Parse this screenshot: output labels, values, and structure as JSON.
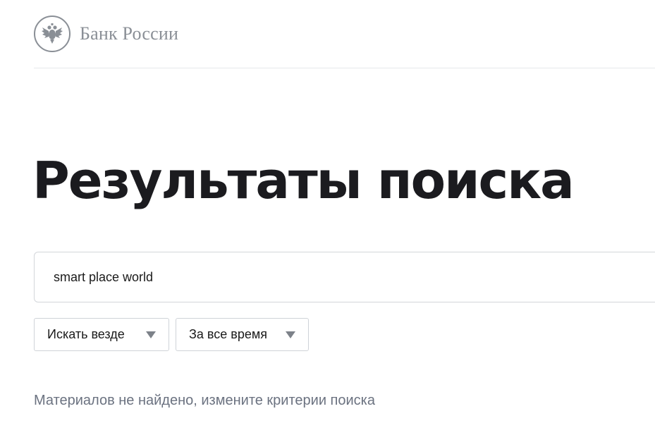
{
  "header": {
    "logo_text": "Банк России"
  },
  "main": {
    "title": "Результаты поиска",
    "search": {
      "value": "smart place world"
    },
    "filters": {
      "scope": "Искать везде",
      "period": "За все время"
    },
    "empty_message": "Материалов не найдено, измените критерии поиска"
  },
  "icons": {
    "logo": "double-headed-eagle-emblem",
    "dropdown": "triangle-down-icon"
  },
  "colors": {
    "logo_gray": "#8a8f96",
    "title": "#1b1b1f",
    "muted_text": "#6b7280",
    "border": "#d3d6da"
  }
}
